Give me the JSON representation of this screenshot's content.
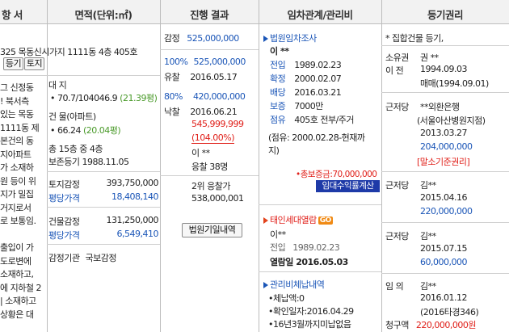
{
  "headers": {
    "col1": "항 서",
    "col2": "면적(단위:㎡)",
    "col3": "진행 결과",
    "col4": "임차관계/관리비",
    "col5": "등기권리"
  },
  "col1": {
    "lines": [
      "그 신정동",
      "! 북서측",
      "있는 목동",
      "1111동 제",
      "본건의 동",
      "지아파트",
      "가 소재하",
      "원 등이 위",
      "지가 밀집",
      "거지로서",
      "로 보통임.",
      "",
      "출입이 가",
      "도로변에",
      " 소재하고,",
      "에 지하철 2",
      "| 소재하고",
      "상황은 대"
    ]
  },
  "col2": {
    "address": "325 목동신시가지 1111동 4층 405호",
    "btn_register": "등기",
    "btn_land": "토지",
    "land_label": "대 지",
    "land_value": "• 70.7/104046.9",
    "land_pyeong": "(21.39평)",
    "building_label": "건 물(아파트)",
    "building_value": "• 66.24",
    "building_pyeong": "(20.04평)",
    "floors": "총 15층 중 4층",
    "reg_date": "보존등기 1988.11.05",
    "land_appraisal_label": "토지감정",
    "land_appraisal_value": "393,750,000",
    "land_avg_label": "평당가격",
    "land_avg_value": "18,408,140",
    "bldg_appraisal_label": "건물감정",
    "bldg_appraisal_value": "131,250,000",
    "bldg_avg_label": "평당가격",
    "bldg_avg_value": "6,549,410",
    "appraiser_label": "감정기관",
    "appraiser_value": "국보감정"
  },
  "col3": {
    "appraisal_label": "감정",
    "appraisal_value": "525,000,000",
    "r1_pct": "100%",
    "r1_value": "525,000,000",
    "r1_status": "유찰",
    "r1_date": "2016.05.17",
    "r2_pct": "80%",
    "r2_value": "420,000,000",
    "sold_label": "낙찰",
    "sold_date": "2016.06.21",
    "sold_price": "545,999,999",
    "sold_ratio": "(104.00%)",
    "winner": "이 **",
    "bidders": "응찰 38명",
    "second_label": "2위 응찰가",
    "second_value": "538,000,001",
    "court_btn": "법원기일내역"
  },
  "col4": {
    "court_title": "법원임차조사",
    "tenant_name": "이 **",
    "move_in_label": "전입",
    "move_in_value": "1989.02.23",
    "fixed_label": "확정",
    "fixed_value": "2000.02.07",
    "dist_label": "배당",
    "dist_value": "2016.03.21",
    "deposit_label": "보증",
    "deposit_value": "7000만",
    "occupy_label": "점유",
    "occupy_value": "405호 전부/주거",
    "occupy_note1": "(점유: 2000.02.28-현재까",
    "occupy_note2": "지)",
    "total_deposit": "•총보증금:70,000,000",
    "calc_btn": "임대수익률계산",
    "resident_title": "태인세대열람",
    "go_badge": "GO",
    "resident_name": "이**",
    "resident_move_label": "전입",
    "resident_move_value": "1989.02.23",
    "resident_view": "열람일 2016.05.03",
    "fee_title": "관리비체납내역",
    "fee_line1": "•체납액:0",
    "fee_line2": "•확인일자:2016.04.29",
    "fee_line3": "•16년3월까지미납없음"
  },
  "col5": {
    "note": "* 집합건물 등기,",
    "owner_label": "소유권",
    "owner_kind": "권 **",
    "transfer_label": "이    전",
    "transfer_date": "1994.09.03",
    "transfer_cause": "매매(1994.09.01)",
    "m1_label": "근저당",
    "m1_name": "**외환은행",
    "m1_branch": "(서울아산병원지점)",
    "m1_date": "2013.03.27",
    "m1_amount": "204,000,000",
    "m1_tag": "[말소기준권리]",
    "m2_label": "근저당",
    "m2_name": "김**",
    "m2_date": "2015.04.16",
    "m2_amount": "220,000,000",
    "m3_label": "근저당",
    "m3_name": "김**",
    "m3_date": "2015.07.15",
    "m3_amount": "60,000,000",
    "s_label": "임    의",
    "s_name": "김**",
    "s_date": "2016.01.12",
    "s_case": "(2016타경346)",
    "s_claim_label": "청구액",
    "s_claim_value": "220,000,000원"
  },
  "colors": {
    "accent_blue": "#1a55b7",
    "accent_red": "#e0201a",
    "accent_green": "#4a9a2a",
    "button_navy": "#1e3aa8",
    "badge_orange": "#f08a14"
  }
}
